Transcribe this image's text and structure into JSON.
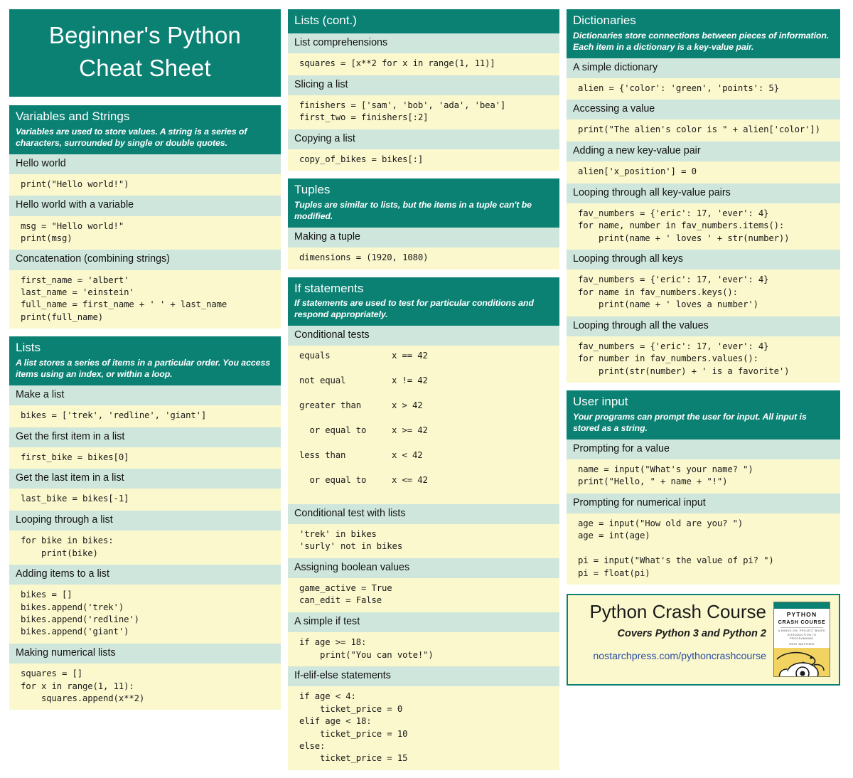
{
  "title": {
    "line1": "Beginner's Python",
    "line2": "Cheat Sheet"
  },
  "columns": {
    "col1": [
      {
        "heading": "Variables and Strings",
        "description": "Variables are used to store values. A string is a series of characters, surrounded by single or double quotes.",
        "entries": [
          {
            "subhead": "Hello world",
            "code": "print(\"Hello world!\")"
          },
          {
            "subhead": "Hello world with a variable",
            "code": "msg = \"Hello world!\"\nprint(msg)"
          },
          {
            "subhead": "Concatenation (combining strings)",
            "code": "first_name = 'albert'\nlast_name = 'einstein'\nfull_name = first_name + ' ' + last_name\nprint(full_name)"
          }
        ]
      },
      {
        "heading": "Lists",
        "description": "A list stores a series of items in a particular order. You access items using an index, or within a loop.",
        "entries": [
          {
            "subhead": "Make a list",
            "code": "bikes = ['trek', 'redline', 'giant']"
          },
          {
            "subhead": "Get the first item in a list",
            "code": "first_bike = bikes[0]"
          },
          {
            "subhead": "Get the last item in a list",
            "code": "last_bike = bikes[-1]"
          },
          {
            "subhead": "Looping through a list",
            "code": "for bike in bikes:\n    print(bike)"
          },
          {
            "subhead": "Adding items to a list",
            "code": "bikes = []\nbikes.append('trek')\nbikes.append('redline')\nbikes.append('giant')"
          },
          {
            "subhead": "Making numerical lists",
            "code": "squares = []\nfor x in range(1, 11):\n    squares.append(x**2)"
          }
        ]
      }
    ],
    "col2": [
      {
        "heading": "Lists (cont.)",
        "description": "",
        "entries": [
          {
            "subhead": "List comprehensions",
            "code": "squares = [x**2 for x in range(1, 11)]"
          },
          {
            "subhead": "Slicing a list",
            "code": "finishers = ['sam', 'bob', 'ada', 'bea']\nfirst_two = finishers[:2]"
          },
          {
            "subhead": "Copying a list",
            "code": "copy_of_bikes = bikes[:]"
          }
        ]
      },
      {
        "heading": "Tuples",
        "description": "Tuples are similar to lists, but the items in a tuple can't be modified.",
        "entries": [
          {
            "subhead": "Making a tuple",
            "code": "dimensions = (1920, 1080)"
          }
        ]
      },
      {
        "heading": "If statements",
        "description": "If statements are used to test for particular conditions and respond appropriately.",
        "entries": [
          {
            "subhead": "Conditional tests",
            "table": [
              {
                "label": "equals",
                "expr": "x == 42"
              },
              {
                "label": "not equal",
                "expr": "x != 42"
              },
              {
                "label": "greater than",
                "expr": "x > 42"
              },
              {
                "label": "  or equal to",
                "expr": "x >= 42"
              },
              {
                "label": "less than",
                "expr": "x < 42"
              },
              {
                "label": "  or equal to",
                "expr": "x <= 42"
              }
            ]
          },
          {
            "subhead": "Conditional test with lists",
            "code": "'trek' in bikes\n'surly' not in bikes"
          },
          {
            "subhead": "Assigning boolean values",
            "code": "game_active = True\ncan_edit = False"
          },
          {
            "subhead": "A simple if test",
            "code": "if age >= 18:\n    print(\"You can vote!\")"
          },
          {
            "subhead": "If-elif-else statements",
            "code": "if age < 4:\n    ticket_price = 0\nelif age < 18:\n    ticket_price = 10\nelse:\n    ticket_price = 15"
          }
        ]
      }
    ],
    "col3": [
      {
        "heading": "Dictionaries",
        "description": "Dictionaries store connections between pieces of information. Each item in a dictionary is a key-value pair.",
        "entries": [
          {
            "subhead": "A simple dictionary",
            "code": "alien = {'color': 'green', 'points': 5}"
          },
          {
            "subhead": "Accessing a value",
            "code": "print(\"The alien's color is \" + alien['color'])"
          },
          {
            "subhead": "Adding a new key-value pair",
            "code": "alien['x_position'] = 0"
          },
          {
            "subhead": "Looping through all key-value pairs",
            "code": "fav_numbers = {'eric': 17, 'ever': 4}\nfor name, number in fav_numbers.items():\n    print(name + ' loves ' + str(number))"
          },
          {
            "subhead": "Looping through all keys",
            "code": "fav_numbers = {'eric': 17, 'ever': 4}\nfor name in fav_numbers.keys():\n    print(name + ' loves a number')"
          },
          {
            "subhead": "Looping through all the values",
            "code": "fav_numbers = {'eric': 17, 'ever': 4}\nfor number in fav_numbers.values():\n    print(str(number) + ' is a favorite')"
          }
        ]
      },
      {
        "heading": "User input",
        "description": "Your programs can prompt the user for input. All input is stored as a string.",
        "entries": [
          {
            "subhead": "Prompting for a value",
            "code": "name = input(\"What's your name? \")\nprint(\"Hello, \" + name + \"!\")"
          },
          {
            "subhead": "Prompting for numerical input",
            "code": "age = input(\"How old are you? \")\nage = int(age)\n\npi = input(\"What's the value of pi? \")\npi = float(pi)"
          }
        ]
      }
    ]
  },
  "promo": {
    "title": "Python Crash Course",
    "subtitle": "Covers Python 3 and Python 2",
    "url": "nostarchpress.com/pythoncrashcourse",
    "book_cover": {
      "title_line1": "PYTHON",
      "title_line2": "CRASH COURSE",
      "subtitle_line1": "A HANDS-ON, PROJECT-BASED",
      "subtitle_line2": "INTRODUCTION TO PROGRAMMING",
      "author": "ERIC MATTHES"
    }
  },
  "colors": {
    "teal": "#0b8174",
    "subhead_mint": "#cfe6dd",
    "code_yellow": "#fbf8cd",
    "link_blue": "#2b4ea2",
    "book_yellow": "#f2d361"
  }
}
